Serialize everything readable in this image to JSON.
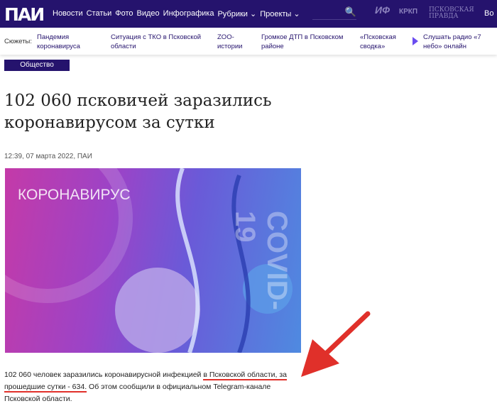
{
  "header": {
    "logo": "ПАИ",
    "nav": [
      "Новости",
      "Статьи",
      "Фото",
      "Видео",
      "Инфографика",
      "Рубрики ⌄",
      "Проекты ⌄"
    ],
    "search_icon": "🔍",
    "partners": [
      "ИФ",
      "КРКП",
      "ПСКОВСКАЯ ПРАВДА"
    ],
    "more": "Во"
  },
  "stories": {
    "label": "Сюжеты:",
    "items": [
      "Пандемия коронавируса",
      "Ситуация с ТКО в Псковской области",
      "ZOO-истории",
      "Громкое ДТП в Псковском районе",
      "«Псковская сводка»"
    ],
    "radio": "Слушать радио «7 небо» онлайн"
  },
  "article": {
    "category": "Общество",
    "title": "102 060 псковичей заразились коронавирусом за сутки",
    "meta": "12:39, 07 марта 2022, ПАИ",
    "image_text": "КОРОНАВИРУС",
    "image_text2": "COVID-19",
    "p1": "102 060 человек заразились коронавирусной инфекцией ",
    "p2": "в Псковской области, за",
    "p3": "прошедшие сутки - 634.",
    "p4": " Об этом сообщили в официальном Telegram-канале Псковской области."
  },
  "colors": {
    "brand": "#25136d",
    "annotation": "#e0302a"
  }
}
